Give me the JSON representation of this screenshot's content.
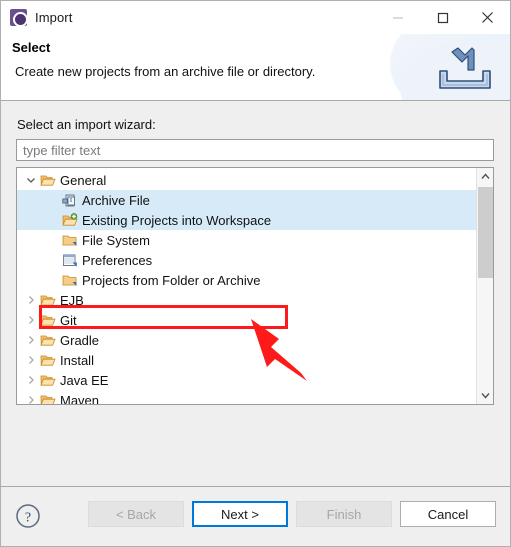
{
  "window": {
    "title": "Import",
    "icon": "eclipse-import-icon",
    "controls": [
      {
        "name": "minimize-button",
        "glyph": "minimize-icon",
        "enabled": false
      },
      {
        "name": "maximize-button",
        "glyph": "maximize-icon",
        "enabled": true
      },
      {
        "name": "close-button",
        "glyph": "close-icon",
        "enabled": true
      }
    ]
  },
  "header": {
    "title": "Select",
    "subtitle": "Create new projects from an archive file or directory.",
    "banner_icon": "import-arrow-into-tray-icon"
  },
  "main": {
    "wizard_label": "Select an import wizard:",
    "filter": {
      "value": "",
      "placeholder": "type filter text"
    },
    "tree": [
      {
        "label": "General",
        "level": 1,
        "icon": "folder-open-icon",
        "twisty": "expanded",
        "selected": false
      },
      {
        "label": "Archive File",
        "level": 2,
        "icon": "archive-file-icon",
        "twisty": "none",
        "selected": true
      },
      {
        "label": "Existing Projects into Workspace",
        "level": 2,
        "icon": "import-project-icon",
        "twisty": "none",
        "selected": true
      },
      {
        "label": "File System",
        "level": 2,
        "icon": "folder-icon",
        "twisty": "none",
        "selected": false
      },
      {
        "label": "Preferences",
        "level": 2,
        "icon": "preferences-icon",
        "twisty": "none",
        "selected": false
      },
      {
        "label": "Projects from Folder or Archive",
        "level": 2,
        "icon": "folder-icon",
        "twisty": "none",
        "selected": false
      },
      {
        "label": "EJB",
        "level": 1,
        "icon": "folder-open-icon",
        "twisty": "collapsed",
        "selected": false
      },
      {
        "label": "Git",
        "level": 1,
        "icon": "folder-open-icon",
        "twisty": "collapsed",
        "selected": false
      },
      {
        "label": "Gradle",
        "level": 1,
        "icon": "folder-open-icon",
        "twisty": "collapsed",
        "selected": false
      },
      {
        "label": "Install",
        "level": 1,
        "icon": "folder-open-icon",
        "twisty": "collapsed",
        "selected": false
      },
      {
        "label": "Java EE",
        "level": 1,
        "icon": "folder-open-icon",
        "twisty": "collapsed",
        "selected": false
      },
      {
        "label": "Maven",
        "level": 1,
        "icon": "folder-open-icon",
        "twisty": "collapsed",
        "selected": false
      }
    ],
    "scrollbar": {
      "up_arrow": "chevron-up-icon",
      "down_arrow": "chevron-down-icon",
      "thumb_top_pct": 1,
      "thumb_height_pct": 45
    }
  },
  "footer": {
    "help_icon": "help-question-icon",
    "buttons": [
      {
        "name": "back-button",
        "label": "< Back",
        "state": "disabled"
      },
      {
        "name": "next-button",
        "label": "Next >",
        "state": "default"
      },
      {
        "name": "finish-button",
        "label": "Finish",
        "state": "disabled"
      },
      {
        "name": "cancel-button",
        "label": "Cancel",
        "state": "enabled"
      }
    ]
  },
  "annotation": {
    "highlight_color": "#fe1a1a",
    "target_label": "Existing Projects into Workspace",
    "shapes": [
      "red-rectangle-highlight",
      "red-arrow-pointer"
    ]
  }
}
